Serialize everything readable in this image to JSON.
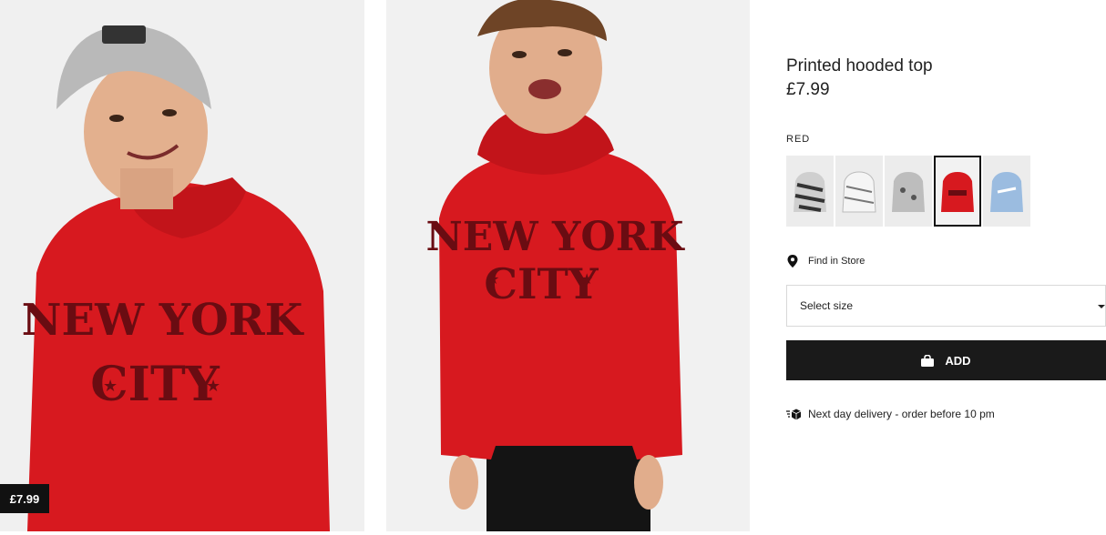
{
  "gallery": {
    "image1_alt": "Boy in red hoodie with grey beanie",
    "image2_alt": "Boy in red hoodie laughing",
    "price_tag": "£7.99",
    "print_line1": "NEW YORK",
    "print_line2": "CITY"
  },
  "product": {
    "title": "Printed hooded top",
    "price": "£7.99",
    "color_label": "RED",
    "swatches": [
      {
        "name": "black-white-pattern",
        "color": "#9a9a9a"
      },
      {
        "name": "white-pattern",
        "color": "#e8e8e8"
      },
      {
        "name": "grey-print",
        "color": "#bdbdbd"
      },
      {
        "name": "red",
        "color": "#d7191f",
        "selected": true
      },
      {
        "name": "light-blue",
        "color": "#9bbce0"
      }
    ]
  },
  "store": {
    "label": "Find in Store"
  },
  "size_select": {
    "label": "Select size"
  },
  "add_button": {
    "label": "ADD"
  },
  "delivery": {
    "text": "Next day delivery - order before 10 pm"
  },
  "colors": {
    "accent": "#1a1a1a",
    "hoodie": "#d7191f",
    "print": "#6a0c12"
  }
}
